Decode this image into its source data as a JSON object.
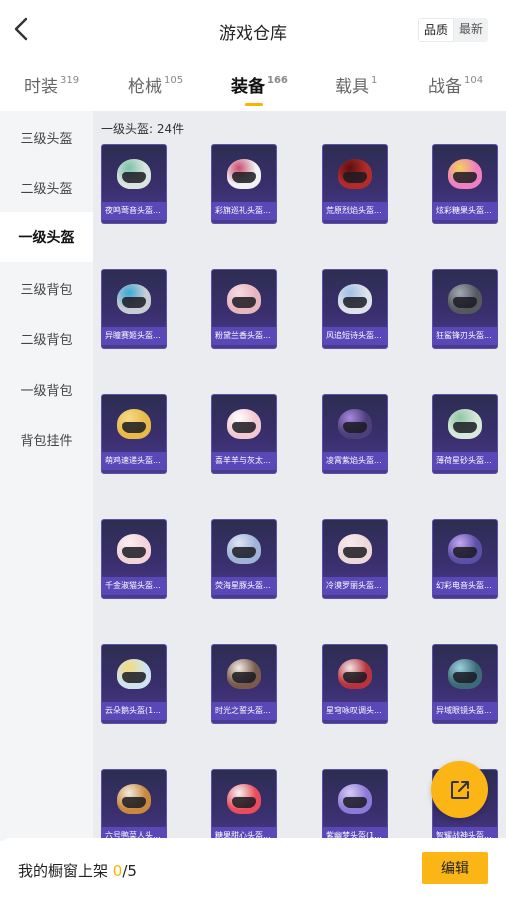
{
  "header": {
    "title": "游戏仓库",
    "sort": {
      "options": [
        "品质",
        "最新"
      ],
      "active_index": 0
    }
  },
  "tabs": [
    {
      "label": "时装",
      "count": "319"
    },
    {
      "label": "枪械",
      "count": "105"
    },
    {
      "label": "装备",
      "count": "166",
      "active": true
    },
    {
      "label": "载具",
      "count": "1"
    },
    {
      "label": "战备",
      "count": "104"
    }
  ],
  "sidebar": {
    "items": [
      "三级头盔",
      "二级头盔",
      "一级头盔",
      "三级背包",
      "二级背包",
      "一级背包",
      "背包挂件"
    ],
    "active_index": 2
  },
  "grid": {
    "count_label": "一级头盔: 24件",
    "items": [
      {
        "name": "夜鸣莺音头盔...",
        "color": "#d9e6e0",
        "accent": "#7fc1a8"
      },
      {
        "name": "彩旗巡礼头盔...",
        "color": "#f2f2f4",
        "accent": "#c94b6e"
      },
      {
        "name": "荒原烈焰头盔...",
        "color": "#b32c2a",
        "accent": "#5b1010"
      },
      {
        "name": "炫彩糖果头盔...",
        "color": "#ee7fc0",
        "accent": "#f5d25a"
      },
      {
        "name": "异瞳赛姬头盔...",
        "color": "#c8cdd3",
        "accent": "#3aa9d6"
      },
      {
        "name": "粉黛兰香头盔...",
        "color": "#e6b6bf",
        "accent": "#f5dbe0"
      },
      {
        "name": "风追短诗头盔...",
        "color": "#dde2ec",
        "accent": "#9ec0e4"
      },
      {
        "name": "狂鲨锋刃头盔...",
        "color": "#54585f",
        "accent": "#a3aab4"
      },
      {
        "name": "萌鸡速递头盔...",
        "color": "#e8b94a",
        "accent": "#f5dc86"
      },
      {
        "name": "喜羊羊与灰太...",
        "color": "#f2c8d2",
        "accent": "#ffffff"
      },
      {
        "name": "凌霄紫焰头盔...",
        "color": "#4d3f7a",
        "accent": "#a889e0"
      },
      {
        "name": "薄荷星砂头盔...",
        "color": "#d8e8dc",
        "accent": "#8fc7a2"
      },
      {
        "name": "千金淑猫头盔...",
        "color": "#f1d3d8",
        "accent": "#fbeff1"
      },
      {
        "name": "荧海星豚头盔...",
        "color": "#9fb2d8",
        "accent": "#e0e6f2"
      },
      {
        "name": "冷漠罗丽头盔...",
        "color": "#ecd7da",
        "accent": "#f6eaec"
      },
      {
        "name": "幻彩电音头盔...",
        "color": "#5b4fa6",
        "accent": "#c5a8ef"
      },
      {
        "name": "云朵鹅头盔(1...",
        "color": "#cfe4f0",
        "accent": "#f2dc7a"
      },
      {
        "name": "时光之誓头盔...",
        "color": "#7a5a4c",
        "accent": "#f3ebe4"
      },
      {
        "name": "星穹咏叹调头...",
        "color": "#b8333d",
        "accent": "#f0e6e6"
      },
      {
        "name": "异域眼镜头盔...",
        "color": "#3d6a78",
        "accent": "#9cd3de"
      },
      {
        "name": "六号鸭菜人头...",
        "color": "#c7883f",
        "accent": "#f4ecde"
      },
      {
        "name": "糖果甜心头盔...",
        "color": "#e94d5c",
        "accent": "#f5f5f5"
      },
      {
        "name": "紫幽梦头盔(1...",
        "color": "#8d7ad8",
        "accent": "#d8ccf5"
      },
      {
        "name": "智耀战神头盔...",
        "color": "#4a4f9a",
        "accent": "#9aa3e6"
      }
    ]
  },
  "bottom": {
    "shelf_label": "我的橱窗上架 ",
    "shelf_current": "0",
    "shelf_total": "/5",
    "edit_label": "编辑"
  },
  "colors": {
    "accent": "#fbb615",
    "card_name_bg": "#5a48b8",
    "grid_bg": "#eaecef",
    "sidebar_bg": "#f4f5f7"
  },
  "icons": {
    "back": "chevron-left-icon",
    "share": "external-link-icon"
  }
}
